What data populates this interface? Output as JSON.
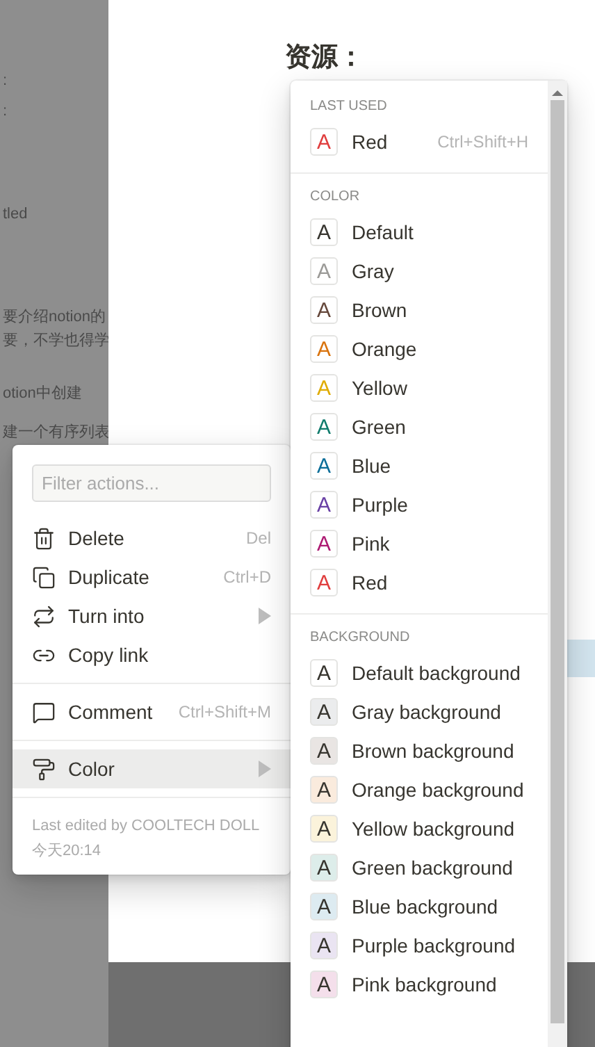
{
  "background_page": {
    "fragments": [
      ":",
      ":",
      "tled",
      "要介绍notion的",
      "要，不学也得学",
      "otion中创建",
      "建一个有序列表"
    ],
    "heading": "资源："
  },
  "block_menu": {
    "filter": {
      "placeholder": "Filter actions..."
    },
    "groups": [
      [
        {
          "label": "Delete",
          "shortcut": "Del",
          "submenu": false,
          "selected": false
        },
        {
          "label": "Duplicate",
          "shortcut": "Ctrl+D",
          "submenu": false,
          "selected": false
        },
        {
          "label": "Turn into",
          "submenu": true,
          "selected": false
        },
        {
          "label": "Copy link",
          "submenu": false,
          "selected": false
        }
      ],
      [
        {
          "label": "Comment",
          "shortcut": "Ctrl+Shift+M",
          "submenu": false,
          "selected": false
        }
      ],
      [
        {
          "label": "Color",
          "submenu": true,
          "selected": true
        }
      ]
    ],
    "footer": [
      "Last edited by COOLTECH DOLL",
      "今天20:14"
    ]
  },
  "color_menu": {
    "sections": [
      {
        "title": "LAST USED",
        "items": [
          {
            "glyph": "A",
            "label": "Red",
            "kind": "text",
            "color": "#e03e3e",
            "shortcut": "Ctrl+Shift+H"
          }
        ]
      },
      {
        "title": "COLOR",
        "items": [
          {
            "glyph": "A",
            "label": "Default",
            "kind": "text",
            "color": "#37352f"
          },
          {
            "glyph": "A",
            "label": "Gray",
            "kind": "text",
            "color": "#9b9a97"
          },
          {
            "glyph": "A",
            "label": "Brown",
            "kind": "text",
            "color": "#64473a"
          },
          {
            "glyph": "A",
            "label": "Orange",
            "kind": "text",
            "color": "#d9730d"
          },
          {
            "glyph": "A",
            "label": "Yellow",
            "kind": "text",
            "color": "#dfab01"
          },
          {
            "glyph": "A",
            "label": "Green",
            "kind": "text",
            "color": "#0f7b6c"
          },
          {
            "glyph": "A",
            "label": "Blue",
            "kind": "text",
            "color": "#0b6e99"
          },
          {
            "glyph": "A",
            "label": "Purple",
            "kind": "text",
            "color": "#6940a5"
          },
          {
            "glyph": "A",
            "label": "Pink",
            "kind": "text",
            "color": "#ad1a72"
          },
          {
            "glyph": "A",
            "label": "Red",
            "kind": "text",
            "color": "#e03e3e"
          }
        ]
      },
      {
        "title": "BACKGROUND",
        "items": [
          {
            "glyph": "A",
            "label": "Default background",
            "kind": "background",
            "color": "#ffffff"
          },
          {
            "glyph": "A",
            "label": "Gray background",
            "kind": "background",
            "color": "#ebeced"
          },
          {
            "glyph": "A",
            "label": "Brown background",
            "kind": "background",
            "color": "#e9e5e3"
          },
          {
            "glyph": "A",
            "label": "Orange background",
            "kind": "background",
            "color": "#faebdd"
          },
          {
            "glyph": "A",
            "label": "Yellow background",
            "kind": "background",
            "color": "#fbf3db"
          },
          {
            "glyph": "A",
            "label": "Green background",
            "kind": "background",
            "color": "#ddedea"
          },
          {
            "glyph": "A",
            "label": "Blue background",
            "kind": "background",
            "color": "#ddebf1"
          },
          {
            "glyph": "A",
            "label": "Purple background",
            "kind": "background",
            "color": "#eae4f2"
          },
          {
            "glyph": "A",
            "label": "Pink background",
            "kind": "background",
            "color": "#f4dfeb"
          }
        ]
      }
    ]
  }
}
